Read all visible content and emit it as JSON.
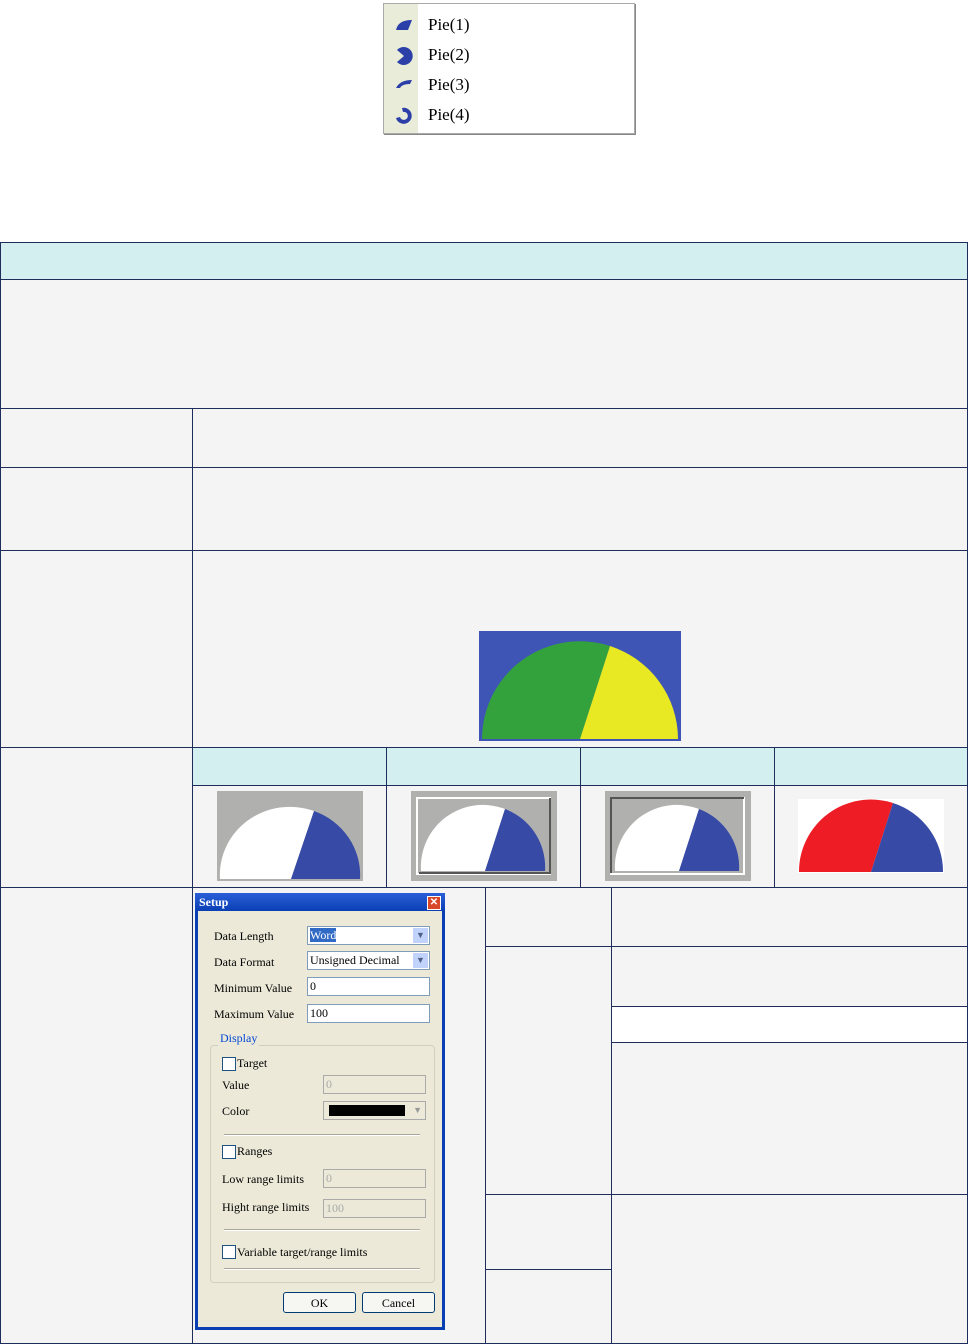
{
  "menu": {
    "items": [
      {
        "label": "Pie(1)",
        "icon": "pie-1-icon"
      },
      {
        "label": "Pie(2)",
        "icon": "pie-2-icon"
      },
      {
        "label": "Pie(3)",
        "icon": "pie-3-icon"
      },
      {
        "label": "Pie(4)",
        "icon": "pie-4-icon"
      }
    ]
  },
  "colors": {
    "border": "#1f2d5a",
    "header": "#d4eff0",
    "gauge_blue": "#3f55b5",
    "gauge_green": "#34a23c",
    "gauge_yellow": "#e8e823",
    "gauge_red": "#ee1c25"
  },
  "dialog": {
    "title": "Setup",
    "data_length_label": "Data Length",
    "data_length_value": "Word",
    "data_format_label": "Data Format",
    "data_format_value": "Unsigned Decimal",
    "min_label": "Minimum Value",
    "min_value": "0",
    "max_label": "Maximum Value",
    "max_value": "100",
    "display_label": "Display",
    "target_label": "Target",
    "value_label": "Value",
    "value_value": "0",
    "color_label": "Color",
    "ranges_label": "Ranges",
    "low_label": "Low range limits",
    "low_value": "0",
    "high_label": "Hight range limits",
    "high_value": "100",
    "variable_label": "Variable target/range limits",
    "ok": "OK",
    "cancel": "Cancel"
  }
}
